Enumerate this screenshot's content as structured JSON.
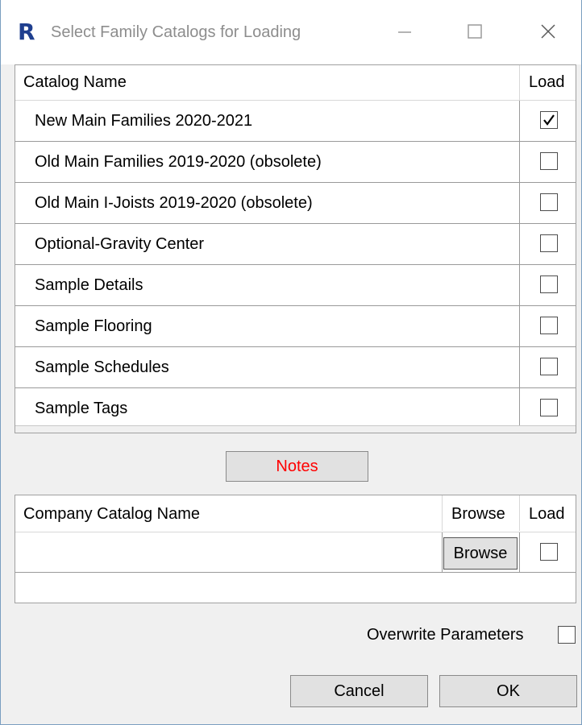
{
  "window": {
    "title": "Select Family Catalogs for Loading",
    "app_icon": "R"
  },
  "catalog_grid": {
    "headers": {
      "name": "Catalog Name",
      "load": "Load"
    },
    "rows": [
      {
        "name": "New Main Families 2020-2021",
        "checked": true
      },
      {
        "name": "Old Main Families 2019-2020 (obsolete)",
        "checked": false
      },
      {
        "name": "Old Main I-Joists 2019-2020 (obsolete)",
        "checked": false
      },
      {
        "name": "Optional-Gravity Center",
        "checked": false
      },
      {
        "name": "Sample Details",
        "checked": false
      },
      {
        "name": "Sample Flooring",
        "checked": false
      },
      {
        "name": "Sample Schedules",
        "checked": false
      },
      {
        "name": "Sample Tags",
        "checked": false
      }
    ]
  },
  "notes_button": {
    "label": "Notes",
    "color": "#ff0000"
  },
  "company_grid": {
    "headers": {
      "name": "Company Catalog Name",
      "browse": "Browse",
      "load": "Load"
    },
    "row": {
      "name": "",
      "browse_label": "Browse",
      "checked": false
    }
  },
  "overwrite": {
    "label": "Overwrite Parameters",
    "checked": false
  },
  "footer": {
    "cancel_label": "Cancel",
    "ok_label": "OK"
  },
  "colors": {
    "accent": "#1f3f8f",
    "border": "#7a9ec0"
  }
}
